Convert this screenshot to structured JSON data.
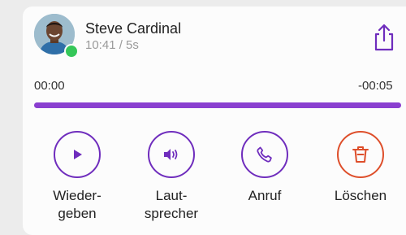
{
  "call": {
    "caller_name": "Steve Cardinal",
    "meta": "10:41 / 5s",
    "status": "online"
  },
  "player": {
    "elapsed": "00:00",
    "remaining": "-00:05",
    "progress": 1.0
  },
  "actions": [
    {
      "label": "Wieder-\ngeben",
      "icon": "play-icon"
    },
    {
      "label": "Laut-\nsprecher",
      "icon": "speaker-icon"
    },
    {
      "label": "Anruf",
      "icon": "phone-icon"
    },
    {
      "label": "Löschen",
      "icon": "trash-icon"
    }
  ],
  "colors": {
    "accent": "#6f2dbd",
    "progress": "#8a3fd0",
    "danger": "#de4f2b",
    "presence": "#35c759"
  }
}
